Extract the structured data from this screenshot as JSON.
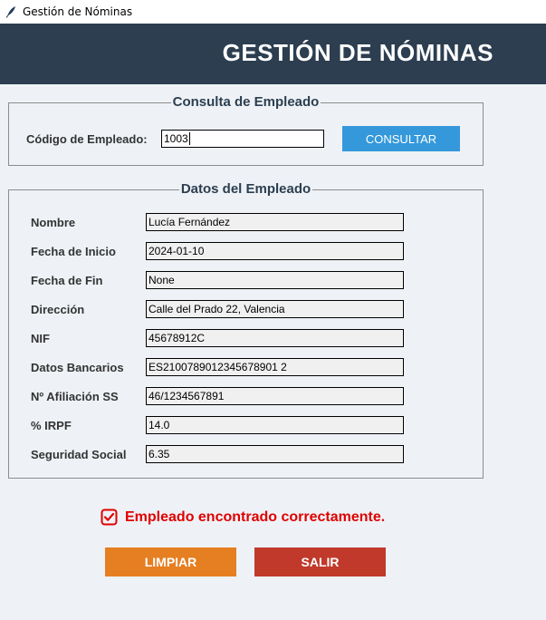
{
  "window": {
    "title": "Gestión de Nóminas"
  },
  "header": {
    "title": "GESTIÓN DE NÓMINAS"
  },
  "consulta": {
    "legend": "Consulta de Empleado",
    "code_label": "Código de Empleado:",
    "code_value": "1003",
    "consult_button": "CONSULTAR"
  },
  "datos": {
    "legend": "Datos del Empleado",
    "fields": [
      {
        "label": "Nombre",
        "value": "Lucía Fernández"
      },
      {
        "label": "Fecha de Inicio",
        "value": "2024-01-10"
      },
      {
        "label": "Fecha de Fin",
        "value": "None"
      },
      {
        "label": "Dirección",
        "value": "Calle del Prado 22, Valencia"
      },
      {
        "label": "NIF",
        "value": "45678912C"
      },
      {
        "label": "Datos Bancarios",
        "value": "ES2100789012345678901 2"
      },
      {
        "label": "Nº Afiliación SS",
        "value": "46/1234567891"
      },
      {
        "label": "% IRPF",
        "value": "14.0"
      },
      {
        "label": "Seguridad Social",
        "value": "6.35"
      }
    ]
  },
  "status": {
    "message": "Empleado encontrado correctamente."
  },
  "actions": {
    "clear_button": "LIMPIAR",
    "exit_button": "SALIR"
  },
  "colors": {
    "header_bg": "#2c3e50",
    "consult_button": "#3498db",
    "clear_button": "#e67e22",
    "exit_button": "#c0392b",
    "status_text": "#e00000"
  }
}
